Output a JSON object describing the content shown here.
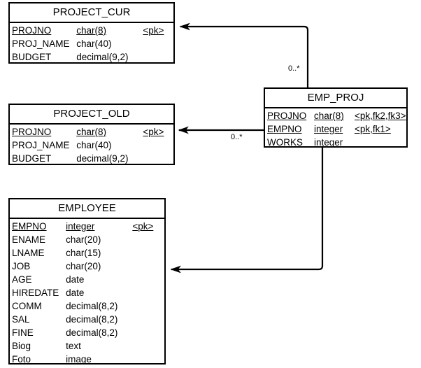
{
  "diagram": {
    "type": "entity-relationship-diagram",
    "background": "#ffffff",
    "line_color": "#000000"
  },
  "entities": [
    {
      "id": "project_cur",
      "name": "PROJECT_CUR",
      "attributes": [
        {
          "name": "PROJNO",
          "type": "char(8)",
          "key": "<pk>",
          "pk": true
        },
        {
          "name": "PROJ_NAME",
          "type": "char(40)",
          "key": "",
          "pk": false
        },
        {
          "name": "BUDGET",
          "type": "decimal(9,2)",
          "key": "",
          "pk": false
        }
      ]
    },
    {
      "id": "project_old",
      "name": "PROJECT_OLD",
      "attributes": [
        {
          "name": "PROJNO",
          "type": "char(8)",
          "key": "<pk>",
          "pk": true
        },
        {
          "name": "PROJ_NAME",
          "type": "char(40)",
          "key": "",
          "pk": false
        },
        {
          "name": "BUDGET",
          "type": "decimal(9,2)",
          "key": "",
          "pk": false
        }
      ]
    },
    {
      "id": "emp_proj",
      "name": "EMP_PROJ",
      "attributes": [
        {
          "name": "PROJNO",
          "type": "char(8)",
          "key": "<pk,fk2,fk3>",
          "pk": true
        },
        {
          "name": "EMPNO",
          "type": "integer",
          "key": "<pk,fk1>",
          "pk": true
        },
        {
          "name": "WORKS",
          "type": "integer",
          "key": "",
          "pk": false
        }
      ]
    },
    {
      "id": "employee",
      "name": "EMPLOYEE",
      "attributes": [
        {
          "name": "EMPNO",
          "type": "integer",
          "key": "<pk>",
          "pk": true
        },
        {
          "name": "ENAME",
          "type": "char(20)",
          "key": "",
          "pk": false
        },
        {
          "name": "LNAME",
          "type": "char(15)",
          "key": "",
          "pk": false
        },
        {
          "name": "JOB",
          "type": "char(20)",
          "key": "",
          "pk": false
        },
        {
          "name": "AGE",
          "type": "date",
          "key": "",
          "pk": false
        },
        {
          "name": "HIREDATE",
          "type": "date",
          "key": "",
          "pk": false
        },
        {
          "name": "COMM",
          "type": "decimal(8,2)",
          "key": "",
          "pk": false
        },
        {
          "name": "SAL",
          "type": "decimal(8,2)",
          "key": "",
          "pk": false
        },
        {
          "name": "FINE",
          "type": "decimal(8,2)",
          "key": "",
          "pk": false
        },
        {
          "name": "Biog",
          "type": "text",
          "key": "",
          "pk": false
        },
        {
          "name": "Foto",
          "type": "image",
          "key": "",
          "pk": false
        }
      ]
    }
  ],
  "relationships": [
    {
      "id": "rel_cur",
      "from": "emp_proj",
      "to": "project_cur",
      "cardinality": "0..*"
    },
    {
      "id": "rel_old",
      "from": "emp_proj",
      "to": "project_old",
      "cardinality": "0..*"
    },
    {
      "id": "rel_empl",
      "from": "emp_proj",
      "to": "employee",
      "cardinality": ""
    }
  ]
}
